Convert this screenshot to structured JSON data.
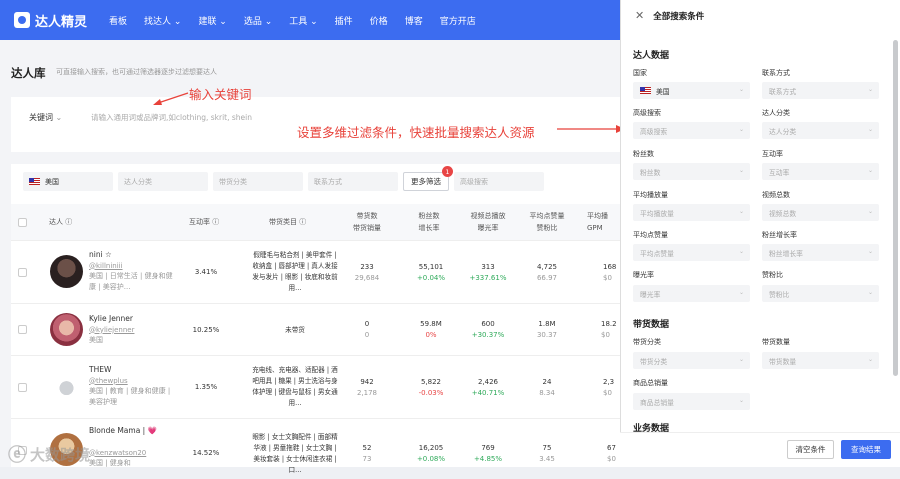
{
  "nav": {
    "logo": "达人精灵",
    "items": [
      "看板",
      "找达人 ⌄",
      "建联 ⌄",
      "选品 ⌄",
      "工具 ⌄",
      "插件",
      "价格",
      "博客",
      "官方开店"
    ]
  },
  "page": {
    "title": "达人库",
    "desc": "可直接输入搜索，也可通过筛选器逐步过滤想要达人"
  },
  "search": {
    "label": "关键词",
    "placeholder": "请输入通用词或品牌词,如clothing, skrit, shein"
  },
  "annotations": {
    "a1": "输入关键词",
    "a2": "设置多维过滤条件，快速批量搜索达人资源"
  },
  "filters": {
    "country": "美国",
    "category": "达人分类",
    "goods": "带货分类",
    "contact": "联系方式",
    "more": "更多筛选",
    "more_badge": "1",
    "adv": "高级搜索"
  },
  "table": {
    "headers": {
      "talent": "达人 ⓘ",
      "rate": "互动率 ⓘ",
      "goods": "带货类目 ⓘ",
      "h4a": "带货数",
      "h4b": "带货销量",
      "h5a": "粉丝数",
      "h5b": "增长率",
      "h6a": "视频总播放",
      "h6b": "曝光率",
      "h7a": "平均点赞量",
      "h7b": "赞粉比",
      "h8a": "平均播",
      "h8b": "GPM"
    },
    "rows": [
      {
        "name": "nini ☆",
        "handle": "@killniniii",
        "tags": "美国 | 日常生活 | 健身和健康 | 美容护...",
        "rate": "3.41%",
        "goods": "假睫毛与粘合剂 | 美甲套件 | 收纳盒 | 唇部护理 | 真人发接发与发片 | 眼影 | 妆底和妆前用...",
        "g1": "233",
        "g2": "29,684",
        "f1": "55,101",
        "f2": "+0.04%",
        "v1": "313",
        "v2": "+337.61%",
        "l1": "4,725",
        "l2": "66.97",
        "p1": "168",
        "p2": "$0"
      },
      {
        "name": "Kylie Jenner",
        "handle": "@kyliejenner",
        "tags": "美国",
        "rate": "10.25%",
        "goods": "未带货",
        "g1": "0",
        "g2": "0",
        "f1": "59.8M",
        "f2": "0%",
        "v1": "600",
        "v2": "+30.37%",
        "l1": "1.8M",
        "l2": "30.37",
        "p1": "18.2",
        "p2": "$0"
      },
      {
        "name": "THEW",
        "handle": "@thewplus",
        "tags": "美国 | 教育 | 健身和健康 | 美容护理",
        "rate": "1.35%",
        "goods": "充电线、充电器、适配器 | 酒吧用具 | 糖果 | 男士洗浴与身体护理 | 键盘与鼠标 | 男女通用...",
        "g1": "942",
        "g2": "2,178",
        "f1": "5,822",
        "f2": "-0.03%",
        "v1": "2,426",
        "v2": "+40.71%",
        "l1": "24",
        "l2": "8.34",
        "p1": "2,3",
        "p2": "$0"
      },
      {
        "name": "Blonde Mama | 💗",
        "handle": "@kenzwatson20",
        "tags": "美国 | 健身和",
        "rate": "14.52%",
        "goods": "眼影 | 女士文胸配件 | 面部精华液 | 男童拖鞋 | 女士文胸 | 美妆套装 | 女士休闲连衣裙 | 口...",
        "g1": "52",
        "g2": "73",
        "f1": "16,205",
        "f2": "+0.08%",
        "v1": "769",
        "v2": "+4.85%",
        "l1": "75",
        "l2": "3.45",
        "p1": "67",
        "p2": "$0"
      }
    ]
  },
  "drawer": {
    "title": "全部搜索条件",
    "sec1": "达人数据",
    "sec2": "带货数据",
    "sec3": "业务数据",
    "f_country_label": "国家",
    "f_country_value": "美国",
    "f_contact_label": "联系方式",
    "f_contact_ph": "联系方式",
    "f_adv_label": "高级搜索",
    "f_adv_ph": "高级搜索",
    "f_cat_label": "达人分类",
    "f_cat_ph": "达人分类",
    "f_fans_label": "粉丝数",
    "f_fans_ph": "粉丝数",
    "f_rate_label": "互动率",
    "f_rate_ph": "互动率",
    "f_play_label": "平均播放量",
    "f_play_ph": "平均播放量",
    "f_vids_label": "视频总数",
    "f_vids_ph": "视频总数",
    "f_like_label": "平均点赞量",
    "f_like_ph": "平均点赞量",
    "f_growth_label": "粉丝增长率",
    "f_growth_ph": "粉丝增长率",
    "f_expo_label": "曝光率",
    "f_expo_ph": "曝光率",
    "f_ratio_label": "赞粉比",
    "f_ratio_ph": "赞粉比",
    "f_gcat_label": "带货分类",
    "f_gcat_ph": "带货分类",
    "f_gcnt_label": "带货数量",
    "f_gcnt_ph": "带货数量",
    "f_sales_label": "商品总销量",
    "f_sales_ph": "商品总销量",
    "clear": "清空条件",
    "query": "查询结果"
  },
  "watermark": "大数跨境"
}
